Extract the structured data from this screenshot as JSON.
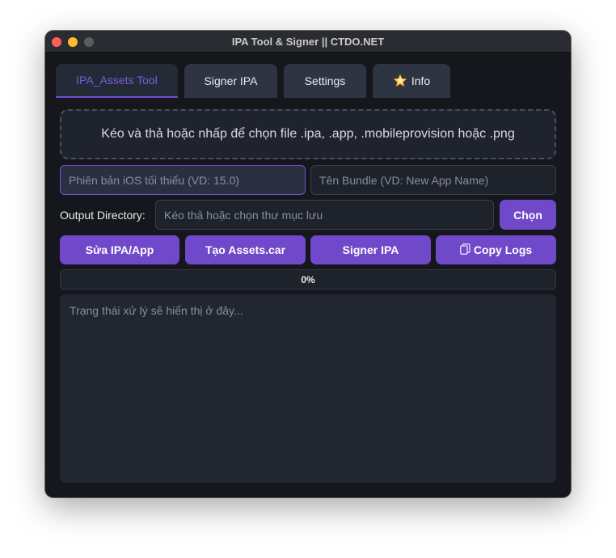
{
  "window": {
    "title": "IPA Tool & Signer || CTDO.NET"
  },
  "tabs": [
    {
      "label": "IPA_Assets Tool",
      "active": true
    },
    {
      "label": "Signer IPA",
      "active": false
    },
    {
      "label": "Settings",
      "active": false
    },
    {
      "label": "Info",
      "icon": "star-icon",
      "active": false
    }
  ],
  "dropzone": {
    "text": "Kéo và thả hoặc nhấp để chọn file .ipa, .app, .mobileprovision hoặc .png"
  },
  "fields": {
    "min_ios": {
      "value": "",
      "placeholder": "Phiên bản iOS tối thiểu (VD: 15.0)"
    },
    "bundle_name": {
      "value": "",
      "placeholder": "Tên Bundle (VD: New App Name)"
    }
  },
  "output": {
    "label": "Output Directory:",
    "placeholder": "Kéo thả hoặc chọn thư mục lưu",
    "value": "",
    "choose_label": "Chọn"
  },
  "actions": {
    "fix": "Sửa IPA/App",
    "assets": "Tạo Assets.car",
    "sign": "Signer IPA",
    "copy_logs": "Copy Logs",
    "copy_icon": "clipboard-icon"
  },
  "progress": {
    "value": 0,
    "text": "0%"
  },
  "log": {
    "text": "Trạng thái xử lý sẽ hiển thị ở đây..."
  },
  "colors": {
    "accent": "#6f49c9",
    "background": "#15171c",
    "active_tab_text": "#7b5ce0"
  }
}
